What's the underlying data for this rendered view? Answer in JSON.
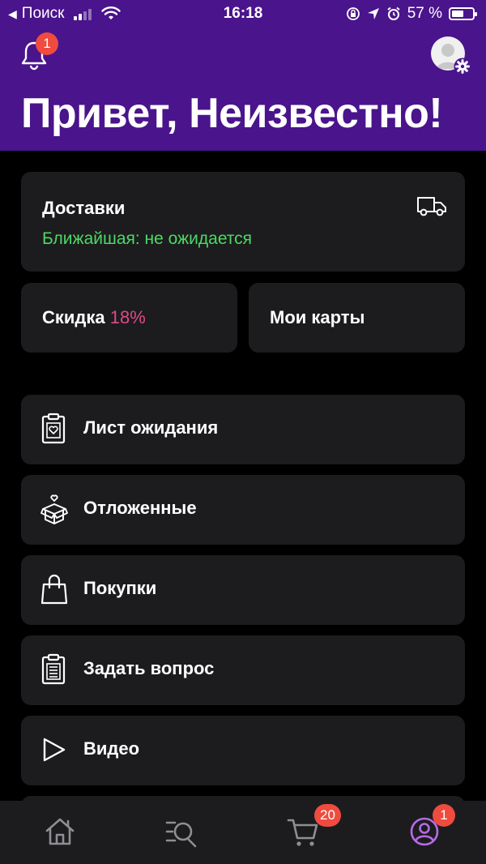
{
  "status_bar": {
    "back_label": "Поиск",
    "time": "16:18",
    "battery": "57 %",
    "battery_level": 0.57
  },
  "header": {
    "notification_count": "1",
    "greeting": "Привет, Неизвестно!"
  },
  "deliveries": {
    "title": "Доставки",
    "subtitle": "Ближайшая: не ожидается"
  },
  "discount": {
    "label": "Скидка",
    "value": "18%"
  },
  "my_cards": {
    "label": "Мои карты"
  },
  "menu": [
    {
      "label": "Лист ожидания",
      "icon": "clipboard-heart-icon"
    },
    {
      "label": "Отложенные",
      "icon": "gift-box-icon"
    },
    {
      "label": "Покупки",
      "icon": "shopping-bag-icon"
    },
    {
      "label": "Задать вопрос",
      "icon": "clipboard-list-icon"
    },
    {
      "label": "Видео",
      "icon": "play-icon"
    }
  ],
  "bottom_nav": {
    "cart_count": "20",
    "profile_count": "1"
  },
  "colors": {
    "header_bg": "#4a148c",
    "card_bg": "#1c1c1e",
    "accent_green": "#4cd964",
    "accent_pink": "#e0488a",
    "badge_red": "#ef4b3f",
    "profile_active": "#b56be6"
  }
}
